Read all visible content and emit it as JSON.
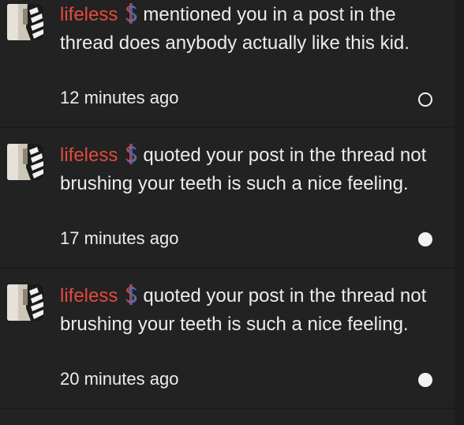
{
  "notifications": [
    {
      "username": "lifeless",
      "badge_icon": "dollar-sign-icon",
      "message": "mentioned you in a post in the thread does anybody actually like this kid.",
      "time": "12 minutes ago",
      "status": "read"
    },
    {
      "username": "lifeless",
      "badge_icon": "dollar-sign-icon",
      "message": "quoted your post in the thread not brushing your teeth is such a nice feeling.",
      "time": "17 minutes ago",
      "status": "unread"
    },
    {
      "username": "lifeless",
      "badge_icon": "dollar-sign-icon",
      "message": "quoted your post in the thread not brushing your teeth is such a nice feeling.",
      "time": "20 minutes ago",
      "status": "unread"
    }
  ],
  "colors": {
    "username": "#e24b3c",
    "background": "#1c1c1d",
    "row_background": "#222223",
    "text": "#ececec"
  }
}
